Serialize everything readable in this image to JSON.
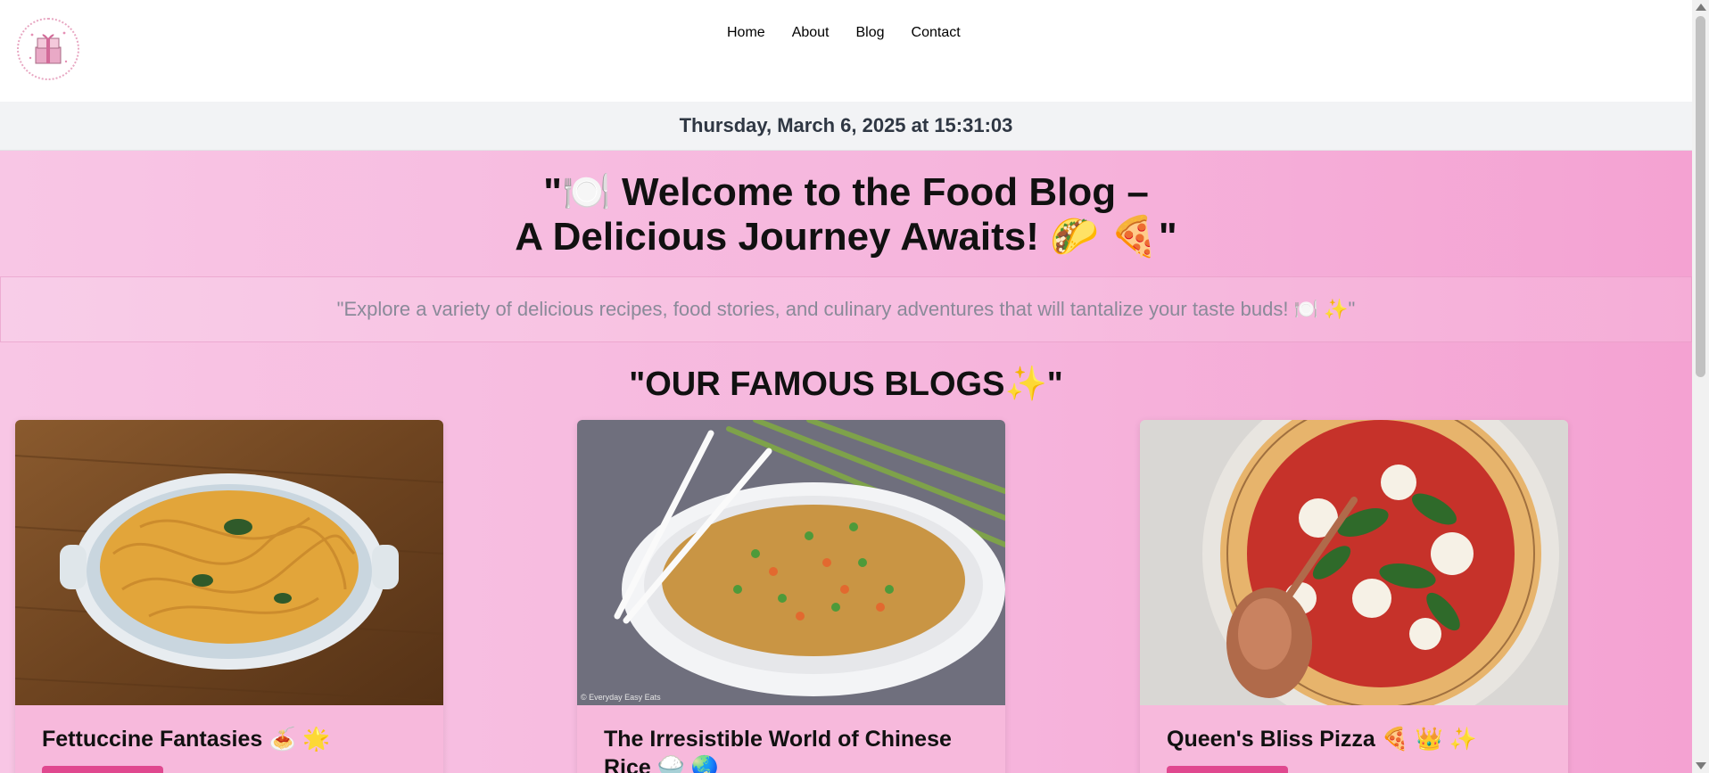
{
  "nav": {
    "items": [
      "Home",
      "About",
      "Blog",
      "Contact"
    ]
  },
  "datebar": {
    "text": "Thursday, March 6, 2025 at 15:31:03"
  },
  "hero": {
    "line1": "\"🍽️ Welcome to the Food Blog –",
    "line2": "A Delicious Journey Awaits! 🌮 🍕\""
  },
  "intro": {
    "text": "\"Explore a variety of delicious recipes, food stories, and culinary adventures that will tantalize your taste buds! 🍽️ ✨\""
  },
  "section": {
    "title": "\"OUR FAMOUS BLOGS✨\""
  },
  "cards": [
    {
      "title": "Fettuccine Fantasies 🍝 🌟",
      "image": "pasta-bowl"
    },
    {
      "title": "The Irresistible World of Chinese Rice 🍚 🌏",
      "image": "fried-rice-bowl",
      "watermark": "© Everyday Easy Eats"
    },
    {
      "title": "Queen's Bliss Pizza 🍕 👑 ✨",
      "image": "margherita-pizza"
    }
  ],
  "colors": {
    "accent": "#e0488f",
    "page_bg_left": "#f8c6e5",
    "page_bg_right": "#f4a2d2",
    "datebar_bg": "#f2f3f5"
  }
}
